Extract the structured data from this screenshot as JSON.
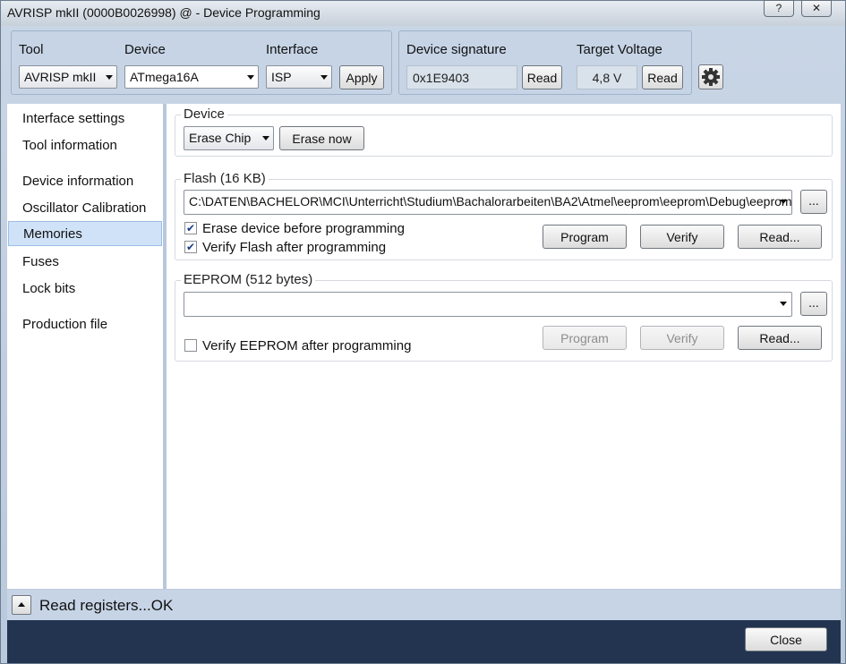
{
  "window": {
    "title": "AVRISP mkII (0000B0026998) @  - Device Programming",
    "help_glyph": "?",
    "close_glyph": "✕"
  },
  "toolbar": {
    "tool_label": "Tool",
    "tool_value": "AVRISP mkII",
    "device_label": "Device",
    "device_value": "ATmega16A",
    "interface_label": "Interface",
    "interface_value": "ISP",
    "apply_label": "Apply",
    "signature_label": "Device signature",
    "signature_value": "0x1E9403",
    "signature_read": "Read",
    "voltage_label": "Target Voltage",
    "voltage_value": "4,8 V",
    "voltage_read": "Read",
    "settings_icon": "gear-icon"
  },
  "sidebar": {
    "items": [
      {
        "label": "Interface settings"
      },
      {
        "label": "Tool information"
      },
      {
        "label": "Device information"
      },
      {
        "label": "Oscillator Calibration"
      },
      {
        "label": "Memories",
        "selected": true
      },
      {
        "label": "Fuses"
      },
      {
        "label": "Lock bits"
      },
      {
        "label": "Production file"
      }
    ]
  },
  "device_section": {
    "title": "Device",
    "erase_mode": "Erase Chip",
    "erase_now": "Erase now"
  },
  "flash_section": {
    "title": "Flash (16 KB)",
    "path": "C:\\DATEN\\BACHELOR\\MCI\\Unterricht\\Studium\\Bachalorarbeiten\\BA2\\Atmel\\eeprom\\eeprom\\Debug\\eeprom.hex",
    "browse": "...",
    "erase_before_label": "Erase device before programming",
    "erase_before_checked": true,
    "verify_label": "Verify Flash after programming",
    "verify_checked": true,
    "program": "Program",
    "verify": "Verify",
    "read": "Read..."
  },
  "eeprom_section": {
    "title": "EEPROM (512 bytes)",
    "path": "",
    "browse": "...",
    "verify_label": "Verify EEPROM after programming",
    "verify_checked": false,
    "program": "Program",
    "verify": "Verify",
    "read": "Read..."
  },
  "status": {
    "text": "Read registers...OK"
  },
  "footer": {
    "close": "Close"
  }
}
